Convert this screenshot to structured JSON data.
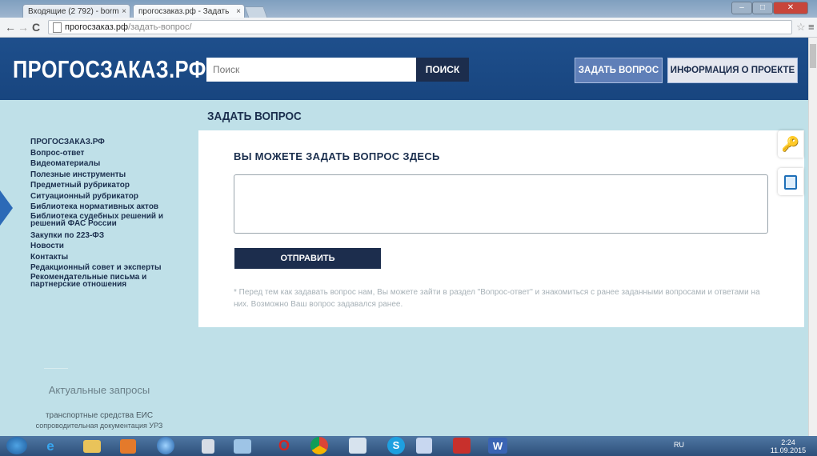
{
  "browser": {
    "tabs": [
      {
        "label": "Входящие (2 792) - borm",
        "active": false
      },
      {
        "label": "прогосзаказ.рф - Задать",
        "active": true
      }
    ],
    "url_domain": "прогосзаказ.рф",
    "url_path": "/задать-вопрос/"
  },
  "header": {
    "logo": "ПРОГОСЗАКАЗ.РФ",
    "search_placeholder": "Поиск",
    "search_button": "ПОИСК",
    "ask_button": "ЗАДАТЬ ВОПРОС",
    "info_button": "ИНФОРМАЦИЯ О ПРОЕКТЕ"
  },
  "sidebar": {
    "items": [
      "ПРОГОСЗАКАЗ.РФ",
      "Вопрос-ответ",
      "Видеоматериалы",
      "Полезные инструменты",
      "Предметный рубрикатор",
      "Ситуационный рубрикатор",
      "Библиотека нормативных актов",
      "Библиотека судебных решений и решений ФАС России",
      "Закупки по 223-ФЗ",
      "Новости",
      "Контакты",
      "Редакционный совет и эксперты",
      "Рекомендательные письма и партнерские отношения"
    ],
    "actual_title": "Актуальные запросы",
    "actual_queries": [
      "транспортные средства ЕИС",
      "сопроводительная документация УРЗ"
    ]
  },
  "main": {
    "page_title": "ЗАДАТЬ ВОПРОС",
    "heading": "ВЫ МОЖЕТЕ ЗАДАТЬ ВОПРОС ЗДЕСЬ",
    "submit_button": "ОТПРАВИТЬ",
    "note": "* Перед тем как задавать вопрос нам, Вы можете зайти в раздел \"Вопрос-ответ\" и знакомиться с ранее заданными вопросами и ответами на них. Возможно Ваш вопрос задавался ранее."
  },
  "taskbar": {
    "lang": "RU",
    "time": "2:24",
    "date": "11.09.2015"
  },
  "icons": [
    "windows-start-icon",
    "internet-explorer-icon",
    "folder-icon",
    "media-player-icon",
    "globe-icon",
    "file-icon",
    "volume-icon",
    "opera-icon",
    "chrome-icon",
    "settings-icon",
    "skype-icon",
    "save-icon",
    "pdf-icon",
    "word-icon",
    "key-icon",
    "document-icon"
  ],
  "colors": {
    "header": "#1e4f8c",
    "sidebar": "#bfe0e8",
    "button_dark": "#1c2d4d",
    "ask_button": "#5f7fb8"
  }
}
